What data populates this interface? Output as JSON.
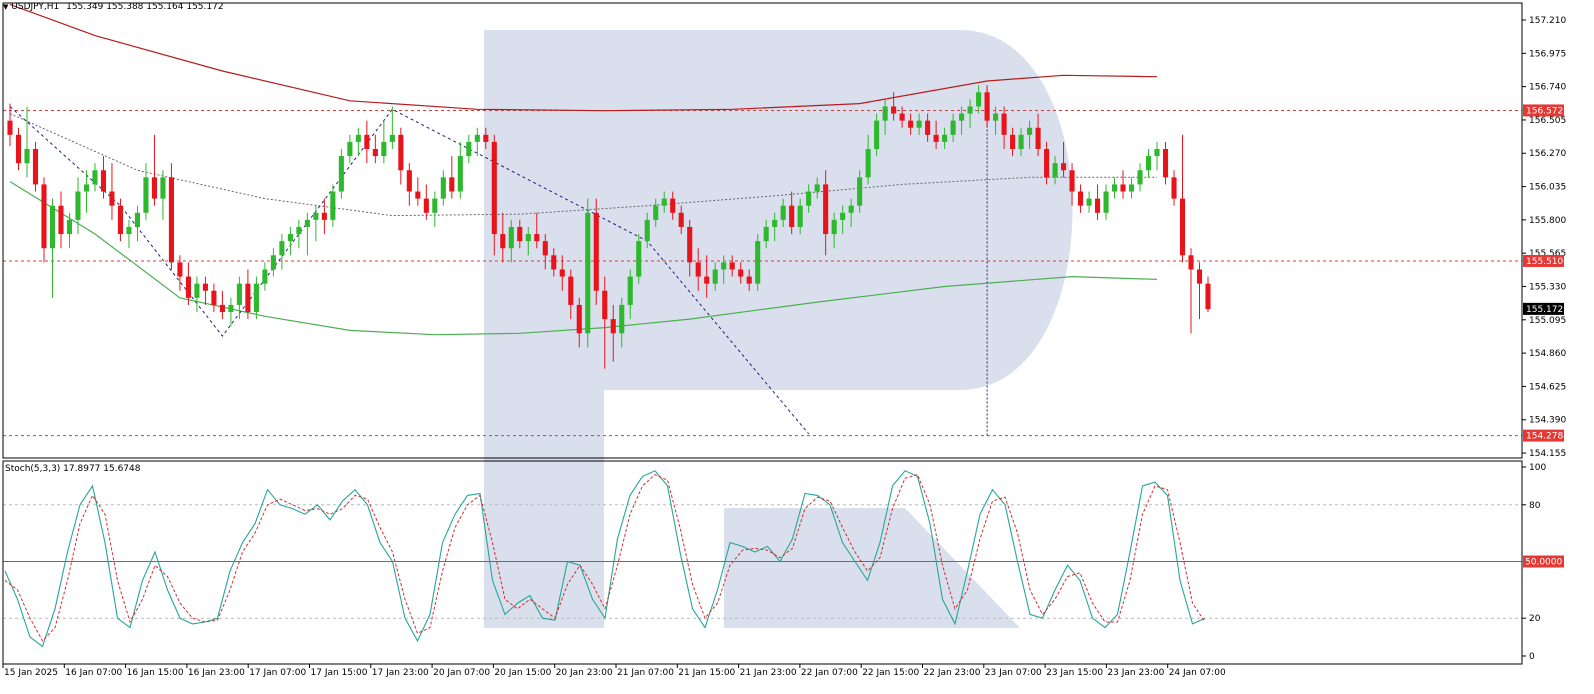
{
  "header": {
    "symbol": "USDJPY,H1",
    "ohlc": "155.349 155.388 155.164 155.172"
  },
  "stoch_header": {
    "label": "Stoch(5,3,3) 17.8977 15.6748"
  },
  "levels": {
    "resistance": "156.572",
    "middle": "155.510",
    "current": "155.172",
    "target": "154.278",
    "stoch_mid": "50.0000"
  },
  "colors": {
    "bull": "#2db82d",
    "bear": "#e8141c",
    "ma_red": "#b71c1c",
    "ma_green": "#4caf50",
    "level_red": "#e53935",
    "dash_blue": "#1a237e",
    "stoch_main": "#26a69a",
    "stoch_signal": "#d32f2f",
    "watermark": "#d5dcea"
  },
  "chart_data": [
    {
      "type": "candlestick",
      "symbol": "USDJPY",
      "timeframe": "H1",
      "y_ticks": [
        "157.210",
        "156.975",
        "156.740",
        "156.505",
        "156.270",
        "156.035",
        "155.800",
        "155.565",
        "155.330",
        "155.095",
        "154.860",
        "154.625",
        "154.390",
        "154.155"
      ],
      "ylim": [
        154.12,
        157.33
      ],
      "x_ticks": [
        "15 Jan 2025",
        "16 Jan 07:00",
        "16 Jan 15:00",
        "16 Jan 23:00",
        "17 Jan 07:00",
        "17 Jan 15:00",
        "17 Jan 23:00",
        "20 Jan 07:00",
        "20 Jan 15:00",
        "20 Jan 23:00",
        "21 Jan 07:00",
        "21 Jan 15:00",
        "21 Jan 23:00",
        "22 Jan 07:00",
        "22 Jan 15:00",
        "22 Jan 23:00",
        "23 Jan 07:00",
        "23 Jan 15:00",
        "23 Jan 23:00",
        "24 Jan 07:00"
      ],
      "candles": [
        [
          156.5,
          156.62,
          156.32,
          156.4
        ],
        [
          156.4,
          156.45,
          156.15,
          156.2
        ],
        [
          156.2,
          156.6,
          156.1,
          156.3
        ],
        [
          156.3,
          156.35,
          156.0,
          156.05
        ],
        [
          156.05,
          156.1,
          155.5,
          155.6
        ],
        [
          155.6,
          155.95,
          155.25,
          155.9
        ],
        [
          155.9,
          156.0,
          155.6,
          155.7
        ],
        [
          155.7,
          155.85,
          155.6,
          155.8
        ],
        [
          155.8,
          156.1,
          155.7,
          156.0
        ],
        [
          156.0,
          156.15,
          155.85,
          156.05
        ],
        [
          156.05,
          156.2,
          156.0,
          156.15
        ],
        [
          156.15,
          156.25,
          155.95,
          156.0
        ],
        [
          156.0,
          156.2,
          155.8,
          155.9
        ],
        [
          155.9,
          155.95,
          155.65,
          155.7
        ],
        [
          155.7,
          155.8,
          155.6,
          155.75
        ],
        [
          155.75,
          155.9,
          155.65,
          155.85
        ],
        [
          155.85,
          156.2,
          155.8,
          156.1
        ],
        [
          156.1,
          156.4,
          155.9,
          155.95
        ],
        [
          155.95,
          156.15,
          155.8,
          156.1
        ],
        [
          156.1,
          156.2,
          155.45,
          155.5
        ],
        [
          155.5,
          155.55,
          155.3,
          155.4
        ],
        [
          155.4,
          155.5,
          155.2,
          155.25
        ],
        [
          155.25,
          155.4,
          155.15,
          155.35
        ],
        [
          155.35,
          155.4,
          155.2,
          155.3
        ],
        [
          155.3,
          155.35,
          155.15,
          155.2
        ],
        [
          155.2,
          155.3,
          155.1,
          155.15
        ],
        [
          155.15,
          155.25,
          155.05,
          155.2
        ],
        [
          155.2,
          155.4,
          155.1,
          155.35
        ],
        [
          155.35,
          155.45,
          155.1,
          155.15
        ],
        [
          155.15,
          155.4,
          155.1,
          155.35
        ],
        [
          155.35,
          155.5,
          155.3,
          155.45
        ],
        [
          155.45,
          155.6,
          155.4,
          155.55
        ],
        [
          155.55,
          155.7,
          155.45,
          155.65
        ],
        [
          155.65,
          155.75,
          155.55,
          155.7
        ],
        [
          155.7,
          155.8,
          155.6,
          155.75
        ],
        [
          155.75,
          155.85,
          155.55,
          155.8
        ],
        [
          155.8,
          155.9,
          155.65,
          155.85
        ],
        [
          155.85,
          155.95,
          155.7,
          155.8
        ],
        [
          155.8,
          156.05,
          155.75,
          156.0
        ],
        [
          156.0,
          156.3,
          155.95,
          156.25
        ],
        [
          156.25,
          156.4,
          156.2,
          156.35
        ],
        [
          156.35,
          156.45,
          156.25,
          156.4
        ],
        [
          156.4,
          156.5,
          156.2,
          156.3
        ],
        [
          156.3,
          156.4,
          156.2,
          156.25
        ],
        [
          156.25,
          156.5,
          156.2,
          156.35
        ],
        [
          156.35,
          156.6,
          156.3,
          156.4
        ],
        [
          156.4,
          156.45,
          156.05,
          156.15
        ],
        [
          156.15,
          156.2,
          155.9,
          156.0
        ],
        [
          156.0,
          156.1,
          155.9,
          155.95
        ],
        [
          155.95,
          156.05,
          155.8,
          155.85
        ],
        [
          155.85,
          156.0,
          155.75,
          155.95
        ],
        [
          155.95,
          156.15,
          155.9,
          156.1
        ],
        [
          156.1,
          156.25,
          155.95,
          156.0
        ],
        [
          156.0,
          156.35,
          155.95,
          156.25
        ],
        [
          156.25,
          156.4,
          156.2,
          156.35
        ],
        [
          156.35,
          156.45,
          156.25,
          156.4
        ],
        [
          156.4,
          156.45,
          156.3,
          156.35
        ],
        [
          156.35,
          156.4,
          155.55,
          155.7
        ],
        [
          155.7,
          155.85,
          155.5,
          155.6
        ],
        [
          155.6,
          155.8,
          155.5,
          155.75
        ],
        [
          155.75,
          155.8,
          155.6,
          155.65
        ],
        [
          155.65,
          155.75,
          155.55,
          155.7
        ],
        [
          155.7,
          155.85,
          155.6,
          155.65
        ],
        [
          155.65,
          155.7,
          155.45,
          155.55
        ],
        [
          155.55,
          155.6,
          155.4,
          155.45
        ],
        [
          155.45,
          155.55,
          155.3,
          155.4
        ],
        [
          155.4,
          155.45,
          155.1,
          155.2
        ],
        [
          155.2,
          155.25,
          154.9,
          155.0
        ],
        [
          155.0,
          155.95,
          154.9,
          155.85
        ],
        [
          155.85,
          155.95,
          155.2,
          155.3
        ],
        [
          155.3,
          155.4,
          154.75,
          155.1
        ],
        [
          155.1,
          155.2,
          154.8,
          155.0
        ],
        [
          155.0,
          155.25,
          154.9,
          155.2
        ],
        [
          155.2,
          155.45,
          155.1,
          155.4
        ],
        [
          155.4,
          155.7,
          155.35,
          155.65
        ],
        [
          155.65,
          155.85,
          155.6,
          155.8
        ],
        [
          155.8,
          155.95,
          155.75,
          155.9
        ],
        [
          155.9,
          156.0,
          155.85,
          155.95
        ],
        [
          155.95,
          156.0,
          155.8,
          155.85
        ],
        [
          155.85,
          155.9,
          155.7,
          155.75
        ],
        [
          155.75,
          155.8,
          155.4,
          155.5
        ],
        [
          155.5,
          155.6,
          155.3,
          155.4
        ],
        [
          155.4,
          155.55,
          155.25,
          155.35
        ],
        [
          155.35,
          155.5,
          155.3,
          155.45
        ],
        [
          155.45,
          155.55,
          155.35,
          155.5
        ],
        [
          155.5,
          155.55,
          155.4,
          155.45
        ],
        [
          155.45,
          155.5,
          155.35,
          155.4
        ],
        [
          155.4,
          155.45,
          155.3,
          155.35
        ],
        [
          155.35,
          155.7,
          155.3,
          155.65
        ],
        [
          155.65,
          155.8,
          155.6,
          155.75
        ],
        [
          155.75,
          155.85,
          155.65,
          155.8
        ],
        [
          155.8,
          155.95,
          155.75,
          155.9
        ],
        [
          155.9,
          156.0,
          155.7,
          155.75
        ],
        [
          155.75,
          155.95,
          155.7,
          155.9
        ],
        [
          155.9,
          156.05,
          155.85,
          156.0
        ],
        [
          156.0,
          156.1,
          155.95,
          156.05
        ],
        [
          156.05,
          156.15,
          155.55,
          155.7
        ],
        [
          155.7,
          155.85,
          155.6,
          155.8
        ],
        [
          155.8,
          155.9,
          155.7,
          155.85
        ],
        [
          155.85,
          155.95,
          155.75,
          155.9
        ],
        [
          155.9,
          156.15,
          155.85,
          156.1
        ],
        [
          156.1,
          156.4,
          156.05,
          156.3
        ],
        [
          156.3,
          156.55,
          156.25,
          156.5
        ],
        [
          156.5,
          156.65,
          156.4,
          156.6
        ],
        [
          156.6,
          156.7,
          156.5,
          156.55
        ],
        [
          156.55,
          156.6,
          156.45,
          156.5
        ],
        [
          156.5,
          156.55,
          156.4,
          156.45
        ],
        [
          156.45,
          156.55,
          156.4,
          156.5
        ],
        [
          156.5,
          156.55,
          156.35,
          156.4
        ],
        [
          156.4,
          156.5,
          156.3,
          156.35
        ],
        [
          156.35,
          156.45,
          156.3,
          156.4
        ],
        [
          156.4,
          156.55,
          156.35,
          156.5
        ],
        [
          156.5,
          156.6,
          156.4,
          156.55
        ],
        [
          156.55,
          156.65,
          156.45,
          156.6
        ],
        [
          156.6,
          156.75,
          156.55,
          156.7
        ],
        [
          156.7,
          156.75,
          156.45,
          156.5
        ],
        [
          156.5,
          156.6,
          156.4,
          156.55
        ],
        [
          156.55,
          156.6,
          156.3,
          156.4
        ],
        [
          156.4,
          156.45,
          156.25,
          156.3
        ],
        [
          156.3,
          156.45,
          156.25,
          156.4
        ],
        [
          156.4,
          156.5,
          156.3,
          156.45
        ],
        [
          156.45,
          156.55,
          156.25,
          156.3
        ],
        [
          156.3,
          156.35,
          156.05,
          156.1
        ],
        [
          156.1,
          156.25,
          156.05,
          156.2
        ],
        [
          156.2,
          156.35,
          156.1,
          156.15
        ],
        [
          156.15,
          156.2,
          155.9,
          156.0
        ],
        [
          156.0,
          156.05,
          155.85,
          155.9
        ],
        [
          155.9,
          156.0,
          155.85,
          155.95
        ],
        [
          155.95,
          156.05,
          155.8,
          155.85
        ],
        [
          155.85,
          156.05,
          155.8,
          156.0
        ],
        [
          156.0,
          156.1,
          155.95,
          156.05
        ],
        [
          156.05,
          156.15,
          155.95,
          156.0
        ],
        [
          156.0,
          156.1,
          155.95,
          156.05
        ],
        [
          156.05,
          156.2,
          156.0,
          156.15
        ],
        [
          156.15,
          156.3,
          156.1,
          156.25
        ],
        [
          156.25,
          156.35,
          156.15,
          156.3
        ],
        [
          156.3,
          156.35,
          156.05,
          156.1
        ],
        [
          156.1,
          156.15,
          155.9,
          155.95
        ],
        [
          155.95,
          156.4,
          155.5,
          155.55
        ],
        [
          155.55,
          155.6,
          155.0,
          155.45
        ],
        [
          155.45,
          155.5,
          155.1,
          155.35
        ],
        [
          155.35,
          155.4,
          155.15,
          155.17
        ]
      ],
      "ma_red": [
        [
          0,
          157.32
        ],
        [
          10,
          157.1
        ],
        [
          25,
          156.85
        ],
        [
          40,
          156.64
        ],
        [
          55,
          156.58
        ],
        [
          70,
          156.57
        ],
        [
          85,
          156.58
        ],
        [
          100,
          156.62
        ],
        [
          115,
          156.78
        ],
        [
          124,
          156.82
        ],
        [
          135,
          156.81
        ]
      ],
      "ma_green": [
        [
          0,
          156.07
        ],
        [
          10,
          155.7
        ],
        [
          20,
          155.25
        ],
        [
          30,
          155.12
        ],
        [
          40,
          155.02
        ],
        [
          50,
          154.99
        ],
        [
          60,
          155.0
        ],
        [
          70,
          155.04
        ],
        [
          80,
          155.1
        ],
        [
          95,
          155.22
        ],
        [
          110,
          155.33
        ],
        [
          125,
          155.4
        ],
        [
          135,
          155.38
        ]
      ],
      "ma_gray": [
        [
          0,
          156.55
        ],
        [
          15,
          156.15
        ],
        [
          30,
          155.95
        ],
        [
          45,
          155.83
        ],
        [
          60,
          155.84
        ],
        [
          75,
          155.9
        ],
        [
          90,
          155.97
        ],
        [
          105,
          156.05
        ],
        [
          120,
          156.1
        ],
        [
          135,
          156.1
        ]
      ],
      "diag_blue": [
        [
          0,
          156.6
        ],
        [
          13,
          155.9
        ],
        [
          25,
          154.98
        ],
        [
          45,
          156.58
        ],
        [
          75,
          155.65
        ],
        [
          94,
          154.29
        ]
      ],
      "vline_index": 115,
      "hlines": [
        156.572,
        155.51,
        154.278
      ]
    },
    {
      "type": "line",
      "title": "Stoch(5,3,3) 17.8977 15.6748",
      "y_ticks": [
        "100",
        "80",
        "50.0000",
        "20",
        "0"
      ],
      "ylim": [
        0,
        100
      ],
      "levels": [
        80,
        50,
        20
      ],
      "main": [
        45,
        30,
        10,
        5,
        25,
        55,
        80,
        90,
        60,
        20,
        15,
        40,
        55,
        35,
        20,
        17,
        18,
        20,
        45,
        60,
        70,
        88,
        80,
        78,
        75,
        80,
        72,
        82,
        88,
        80,
        60,
        50,
        20,
        8,
        22,
        60,
        75,
        85,
        86,
        40,
        22,
        28,
        32,
        20,
        19,
        50,
        48,
        30,
        20,
        62,
        85,
        95,
        98,
        90,
        55,
        25,
        15,
        35,
        60,
        58,
        55,
        58,
        50,
        62,
        86,
        85,
        80,
        60,
        50,
        40,
        60,
        90,
        98,
        95,
        70,
        30,
        17,
        45,
        75,
        88,
        80,
        50,
        22,
        20,
        35,
        48,
        40,
        20,
        15,
        22,
        55,
        90,
        92,
        85,
        40,
        17,
        20
      ],
      "signal": [
        40,
        35,
        20,
        8,
        15,
        40,
        70,
        85,
        75,
        40,
        18,
        30,
        48,
        42,
        28,
        20,
        18,
        19,
        35,
        55,
        65,
        80,
        83,
        80,
        77,
        78,
        75,
        78,
        85,
        83,
        68,
        55,
        30,
        12,
        15,
        45,
        68,
        80,
        85,
        60,
        30,
        25,
        30,
        25,
        20,
        38,
        48,
        38,
        25,
        48,
        75,
        90,
        96,
        93,
        68,
        38,
        20,
        28,
        48,
        56,
        57,
        56,
        52,
        57,
        78,
        84,
        82,
        68,
        55,
        45,
        52,
        78,
        94,
        96,
        80,
        48,
        25,
        35,
        62,
        82,
        84,
        65,
        35,
        22,
        30,
        42,
        44,
        28,
        18,
        18,
        40,
        75,
        90,
        88,
        60,
        28,
        18
      ]
    }
  ]
}
